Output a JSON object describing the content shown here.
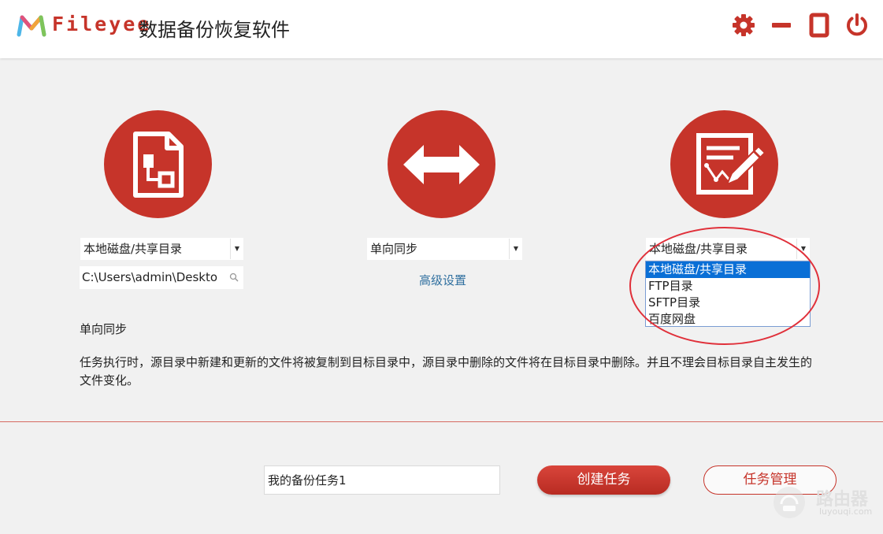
{
  "header": {
    "brand": "Fileyee",
    "title": "数据备份恢复软件",
    "icons": [
      "settings-icon",
      "minimize-icon",
      "maximize-icon",
      "power-icon"
    ],
    "accent_color": "#c6342a"
  },
  "source": {
    "icon": "document-icon",
    "type_select": "本地磁盘/共享目录",
    "path": "C:\\Users\\admin\\Deskto"
  },
  "sync": {
    "icon": "bidirectional-arrow-icon",
    "mode_select": "单向同步",
    "advanced_link": "高级设置"
  },
  "target": {
    "icon": "edit-document-icon",
    "type_select": "本地磁盘/共享目录",
    "dropdown_options": [
      "本地磁盘/共享目录",
      "FTP目录",
      "SFTP目录",
      "百度网盘"
    ],
    "selected_index": 0
  },
  "description": {
    "title": "单向同步",
    "text": "任务执行时，源目录中新建和更新的文件将被复制到目标目录中，源目录中删除的文件将在目标目录中删除。并且不理会目标目录自主发生的文件变化。"
  },
  "footer": {
    "task_name": "我的备份任务1",
    "create_button": "创建任务",
    "manage_button": "任务管理"
  },
  "watermark": {
    "text": "路由器",
    "url": "luyouqi.com"
  }
}
